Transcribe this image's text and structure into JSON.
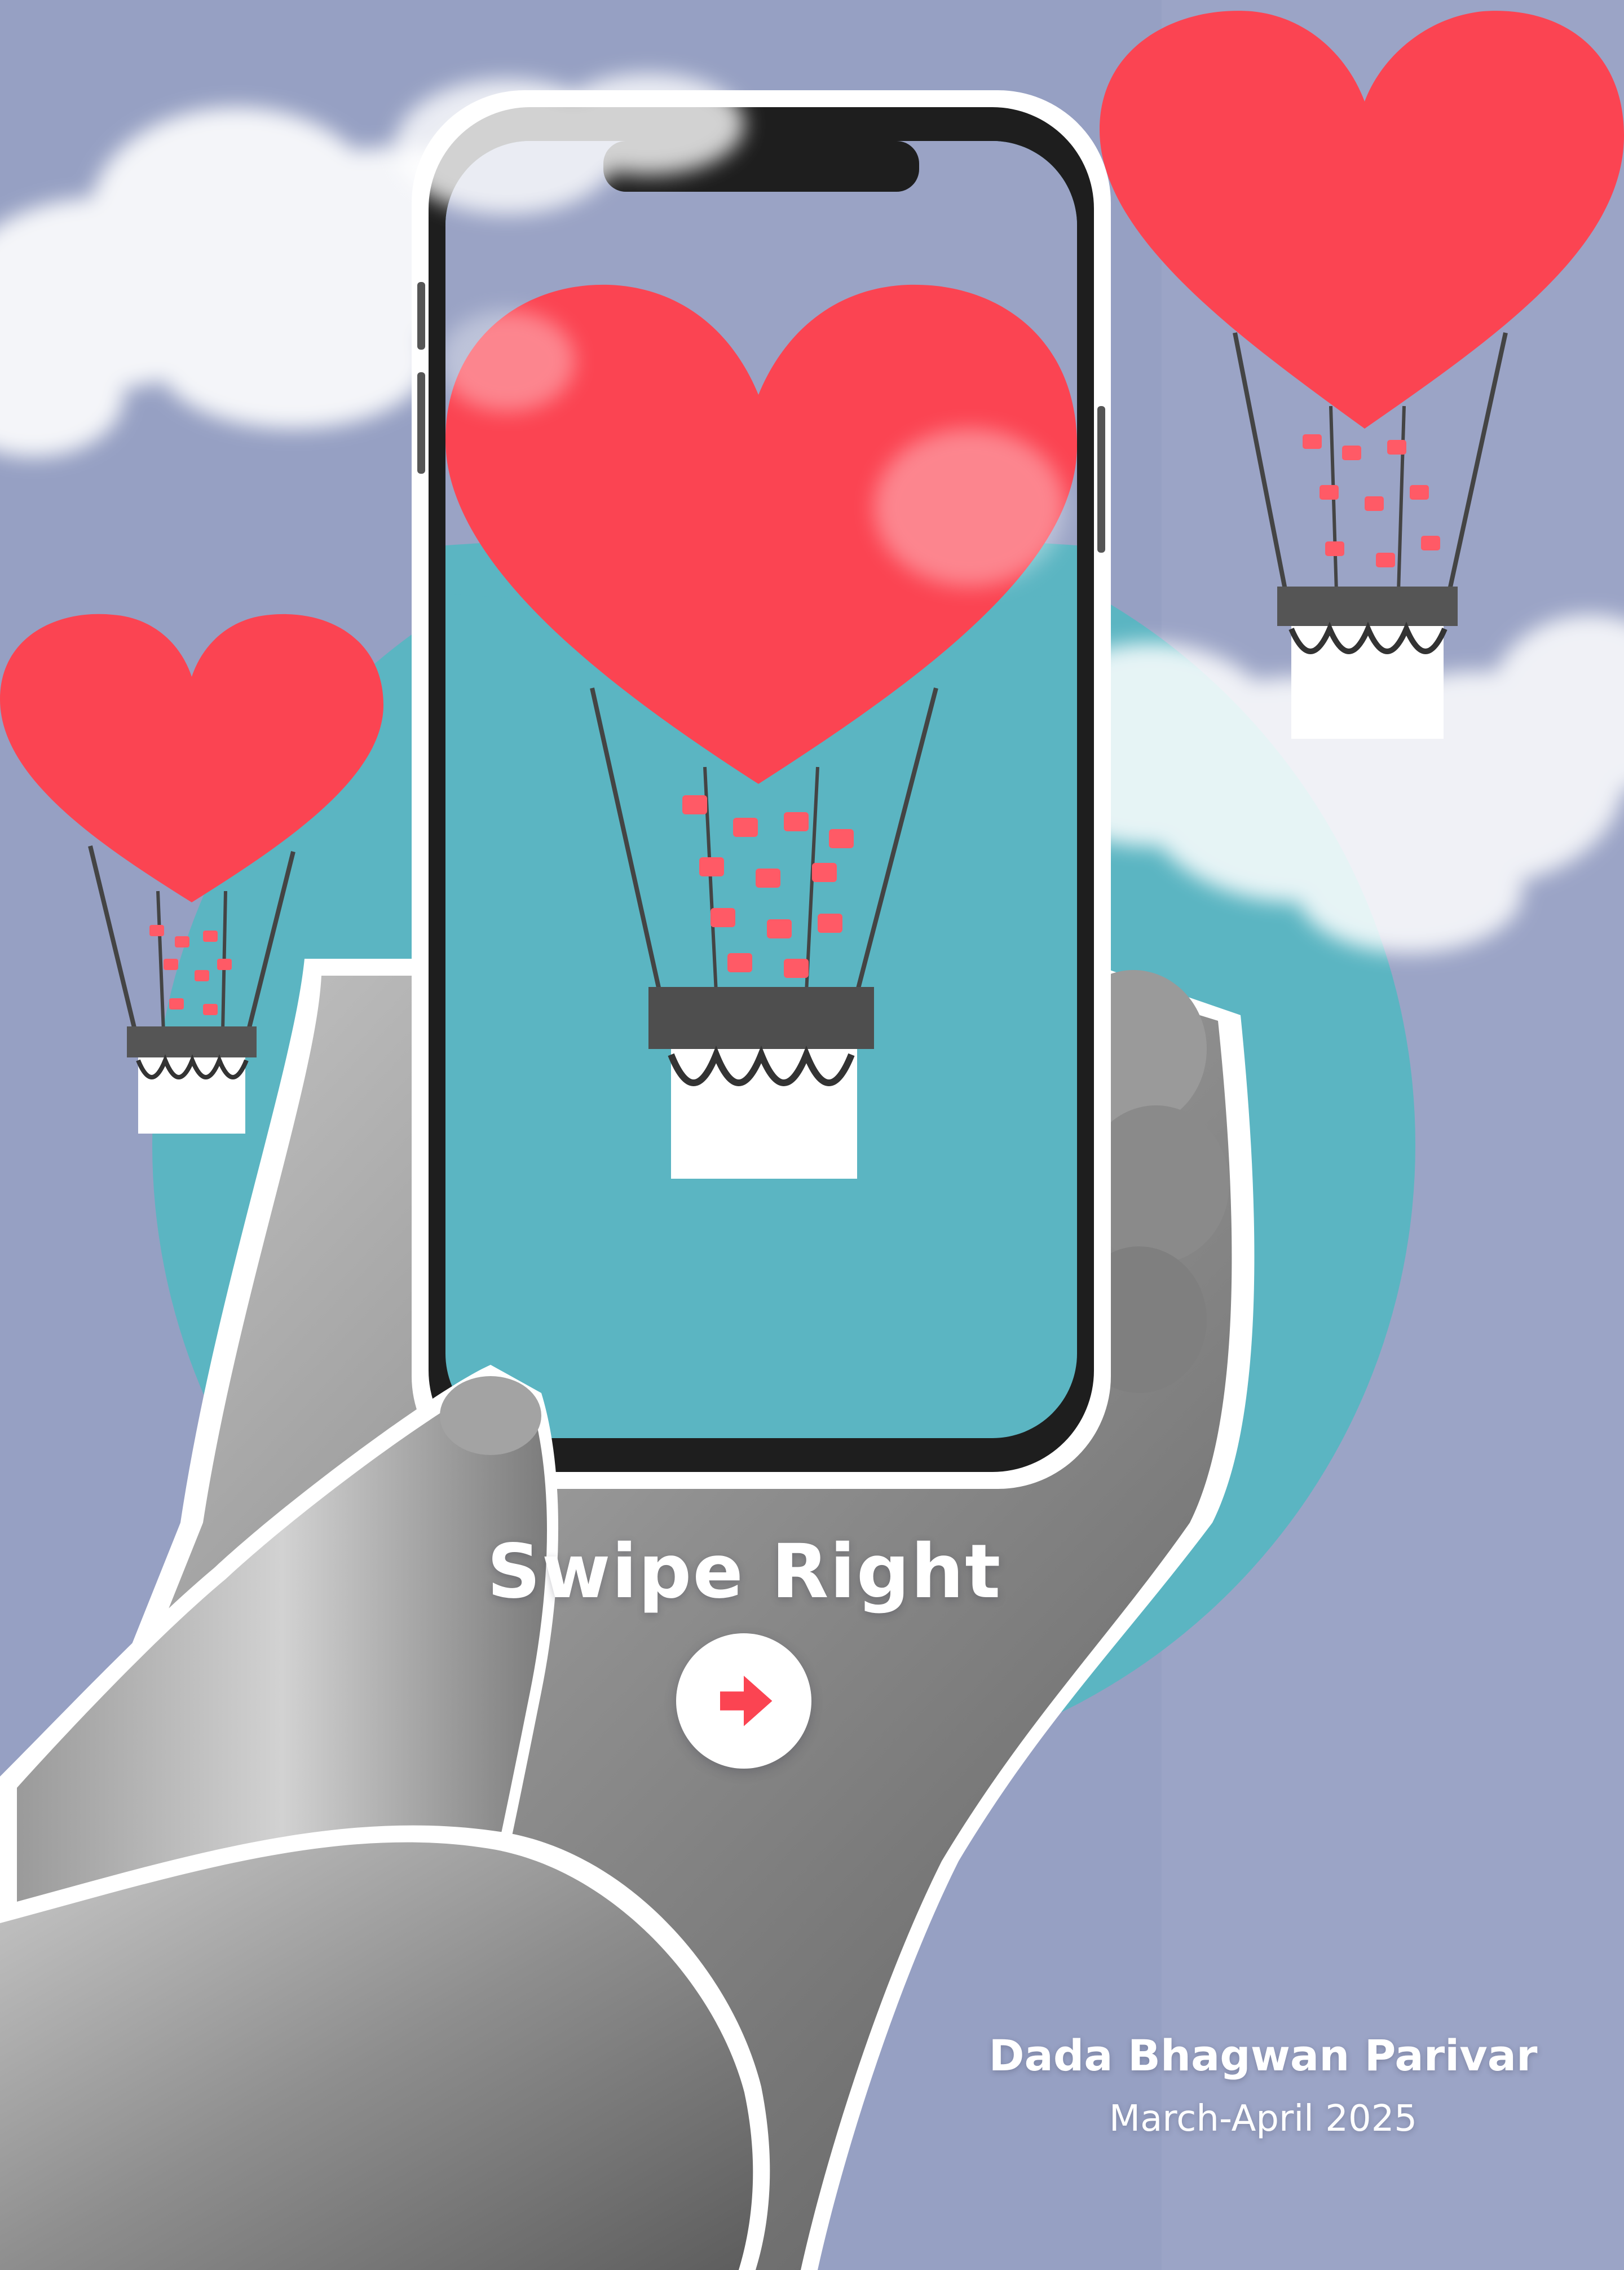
{
  "cover": {
    "headline": "Swipe Right",
    "action_icon": "arrow-right-icon",
    "publisher": "Dada Bhagwan Parivar",
    "issue": "March-April 2025"
  },
  "colors": {
    "background": "#96a0c3",
    "teal_circle": "#5bb5c2",
    "heart": "#fb4452",
    "text": "#ffffff",
    "arrow": "#fb4452"
  },
  "illustration": {
    "balloons": 3,
    "balloon_icon": "heart-balloon-icon",
    "phone_icon": "smartphone-icon",
    "hand_icon": "hand-icon",
    "cloud_icon": "cloud-icon"
  }
}
